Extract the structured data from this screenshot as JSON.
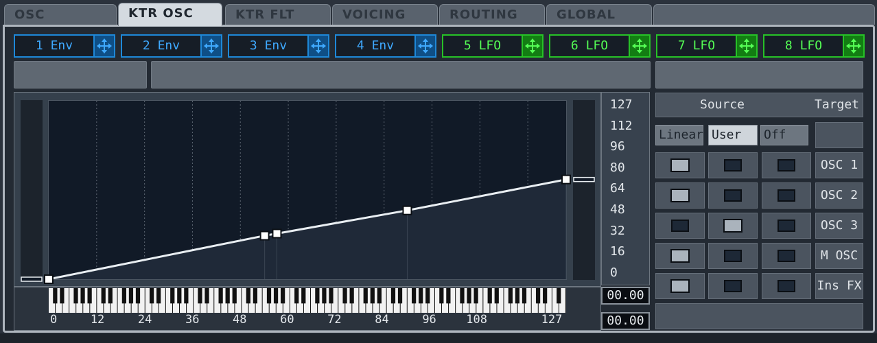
{
  "tabs": [
    "OSC",
    "KTR OSC",
    "KTR FLT",
    "VOICING",
    "ROUTING",
    "GLOBAL"
  ],
  "active_tab": "KTR OSC",
  "mod_sources": [
    {
      "label": "1 Env",
      "type": "env"
    },
    {
      "label": "2 Env",
      "type": "env"
    },
    {
      "label": "3 Env",
      "type": "env"
    },
    {
      "label": "4 Env",
      "type": "env"
    },
    {
      "label": "5 LFO",
      "type": "lfo"
    },
    {
      "label": "6 LFO",
      "type": "lfo"
    },
    {
      "label": "7 LFO",
      "type": "lfo"
    },
    {
      "label": "8 LFO",
      "type": "lfo"
    }
  ],
  "colors": {
    "env": "#3fa9ff",
    "lfo": "#55ff55",
    "curve": "#e9eef2"
  },
  "graph": {
    "y_scale": [
      "127",
      "112",
      "96",
      "80",
      "64",
      "48",
      "32",
      "16",
      "0"
    ],
    "x_scale": [
      "0",
      "12",
      "24",
      "36",
      "48",
      "60",
      "72",
      "84",
      "96",
      "108",
      "127"
    ],
    "points": [
      {
        "note": 0,
        "value": 0
      },
      {
        "note": 53,
        "value": 31
      },
      {
        "note": 56,
        "value": 32.5
      },
      {
        "note": 88,
        "value": 49
      },
      {
        "note": 127,
        "value": 71
      }
    ],
    "readout_value": "00.00",
    "readout_note": "00.00"
  },
  "tracking": {
    "header_source": "Source",
    "header_target": "Target",
    "modes": [
      "Linear",
      "User",
      "Off"
    ],
    "selected_mode": "User",
    "rows": [
      {
        "target": "OSC 1",
        "selection": "Linear"
      },
      {
        "target": "OSC 2",
        "selection": "Linear"
      },
      {
        "target": "OSC 3",
        "selection": "User"
      },
      {
        "target": "M OSC",
        "selection": "Linear"
      },
      {
        "target": "Ins FX",
        "selection": "Linear"
      }
    ]
  }
}
